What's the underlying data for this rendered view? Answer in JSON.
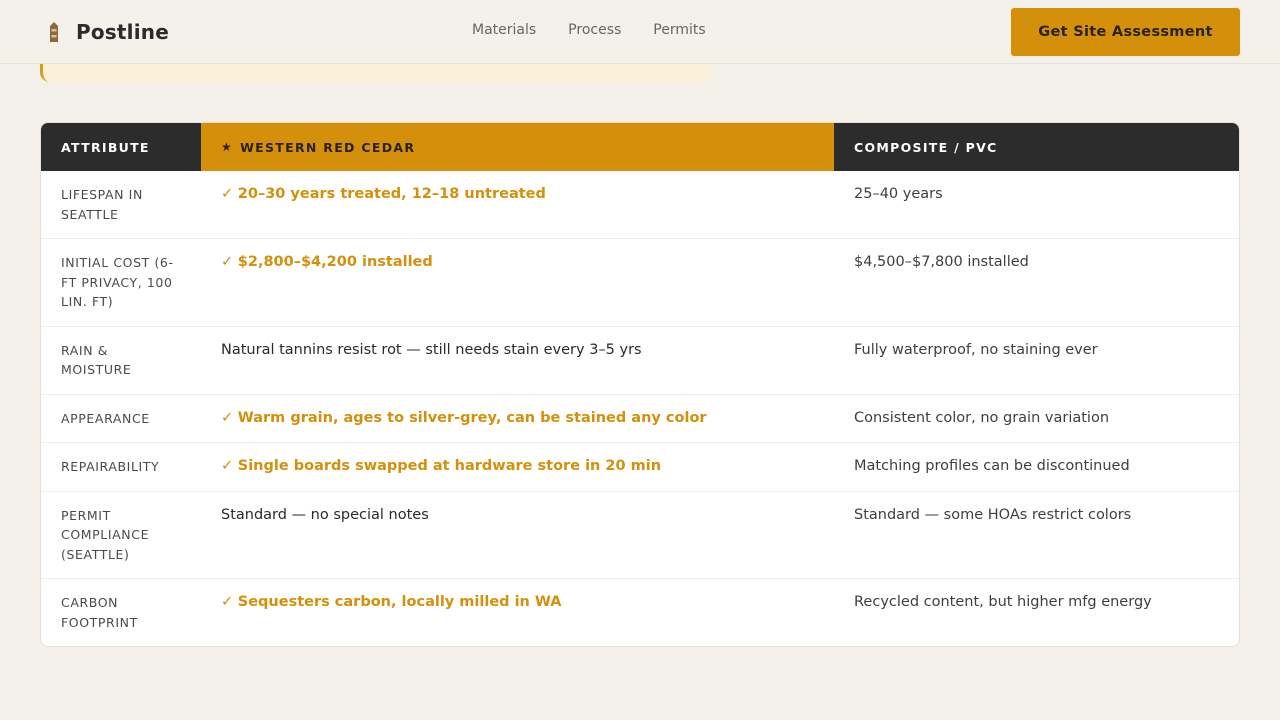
{
  "brand": {
    "name": "Postline",
    "icon": "fence-post-icon"
  },
  "nav": [
    {
      "label": "Materials"
    },
    {
      "label": "Process"
    },
    {
      "label": "Permits"
    }
  ],
  "cta": {
    "label": "Get Site Assessment"
  },
  "colors": {
    "accent": "#d4900b",
    "header_dark": "#2c2c2c",
    "background": "#f3f0e9"
  },
  "table": {
    "headers": {
      "attribute": "Attribute",
      "cedar": "Western Red Cedar",
      "cedar_icon": "star-icon",
      "composite": "Composite / PVC"
    },
    "rows": [
      {
        "attribute": "Lifespan in Seattle",
        "cedar": "20–30 years treated, 12–18 untreated",
        "cedar_win": true,
        "composite": "25–40 years"
      },
      {
        "attribute": "Initial cost (6-ft privacy, 100 lin. ft)",
        "cedar": "$2,800–$4,200 installed",
        "cedar_win": true,
        "composite": "$4,500–$7,800 installed"
      },
      {
        "attribute": "Rain & moisture",
        "cedar": "Natural tannins resist rot — still needs stain every 3–5 yrs",
        "cedar_win": false,
        "composite": "Fully waterproof, no staining ever"
      },
      {
        "attribute": "Appearance",
        "cedar": "Warm grain, ages to silver-grey, can be stained any color",
        "cedar_win": true,
        "composite": "Consistent color, no grain variation"
      },
      {
        "attribute": "Repairability",
        "cedar": "Single boards swapped at hardware store in 20 min",
        "cedar_win": true,
        "composite": "Matching profiles can be discontinued"
      },
      {
        "attribute": "Permit compliance (Seattle)",
        "cedar": "Standard — no special notes",
        "cedar_win": false,
        "composite": "Standard — some HOAs restrict colors"
      },
      {
        "attribute": "Carbon footprint",
        "cedar": "Sequesters carbon, locally milled in WA",
        "cedar_win": true,
        "composite": "Recycled content, but higher mfg energy"
      }
    ]
  }
}
